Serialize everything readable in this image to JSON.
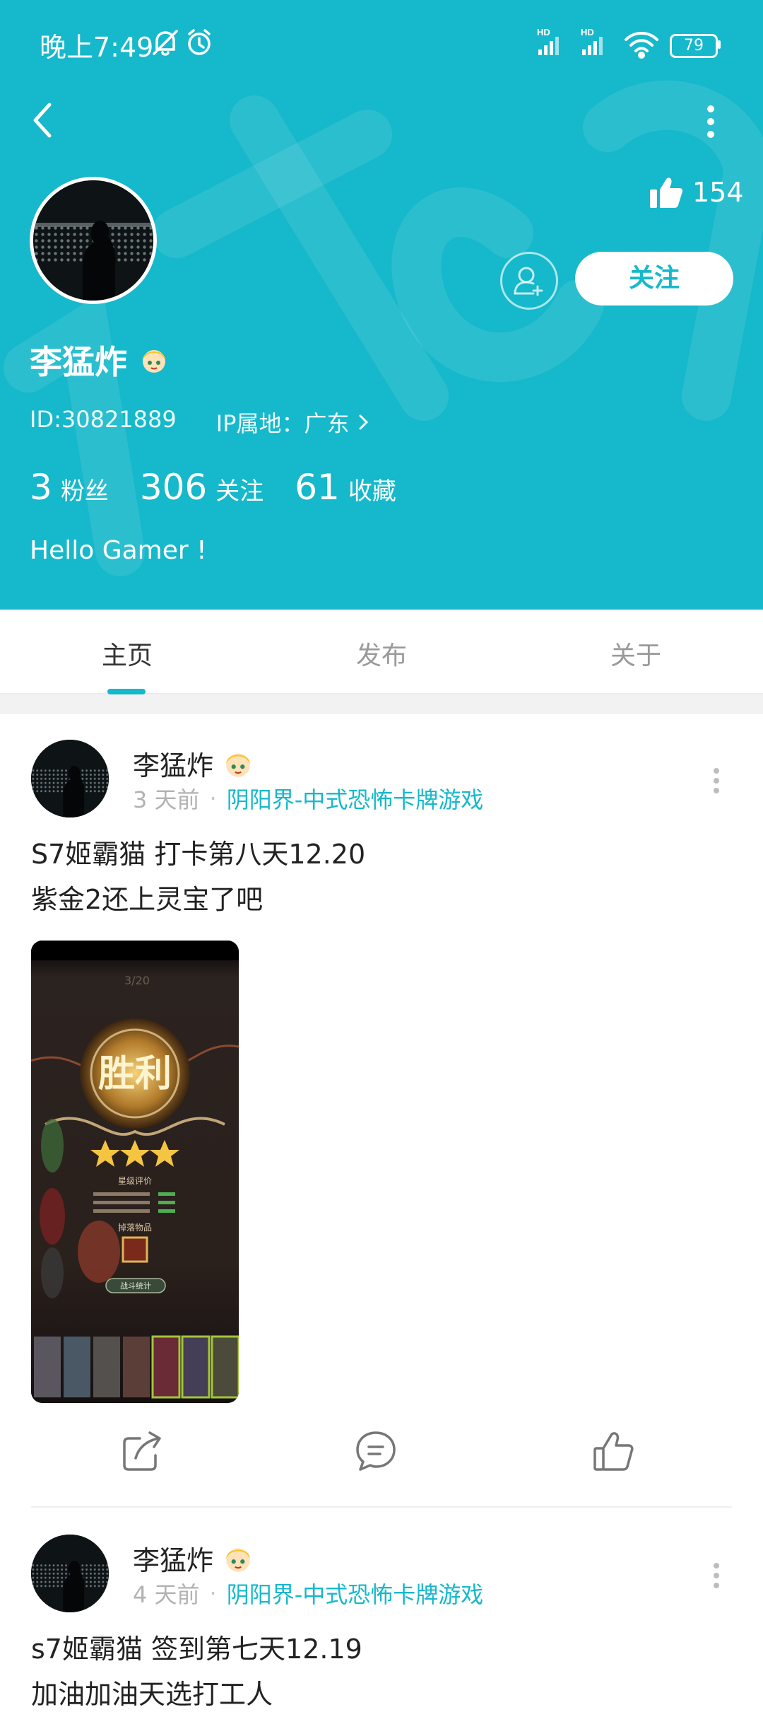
{
  "status_bar": {
    "time": "晚上7:49",
    "battery": "79",
    "hd_labels": [
      "HD",
      "HD"
    ]
  },
  "colors": {
    "accent": "#16b8cb",
    "text_dark": "#222222",
    "text_muted": "#b2b2b2"
  },
  "icons": [
    "back-arrow-icon",
    "more-vertical-icon",
    "thumbs-up-icon",
    "add-friend-icon",
    "mute-icon",
    "alarm-icon",
    "signal-icon",
    "wifi-icon",
    "share-icon",
    "comment-icon",
    "like-icon",
    "emoji-badge-icon"
  ],
  "profile": {
    "likes": "154",
    "add_friend_icon": "add-friend-icon",
    "follow_label": "关注",
    "name": "李猛炸",
    "id_text": "ID:30821889",
    "ip_text": "IP属地：广东",
    "stats": [
      {
        "num": "3",
        "label": "粉丝"
      },
      {
        "num": "306",
        "label": "关注"
      },
      {
        "num": "61",
        "label": "收藏"
      }
    ],
    "bio": "Hello Gamer !"
  },
  "tabs": [
    {
      "label": "主页",
      "active": true
    },
    {
      "label": "发布",
      "active": false
    },
    {
      "label": "关于",
      "active": false
    }
  ],
  "posts": [
    {
      "author": "李猛炸",
      "time": "3 天前",
      "dot": "·",
      "game": "阴阳界-中式恐怖卡牌游戏",
      "lines": [
        "S7姬霸猫 打卡第八天12.20",
        "紫金2还上灵宝了吧"
      ],
      "image_text": {
        "title": "胜利",
        "rating": "星级评价",
        "drops": "掉落物品",
        "stats_btn": "战斗统计",
        "page": "3/20"
      }
    },
    {
      "author": "李猛炸",
      "time": "4 天前",
      "dot": "·",
      "game": "阴阳界-中式恐怖卡牌游戏",
      "lines": [
        "s7姬霸猫 签到第七天12.19",
        "加油加油天选打工人"
      ]
    }
  ]
}
